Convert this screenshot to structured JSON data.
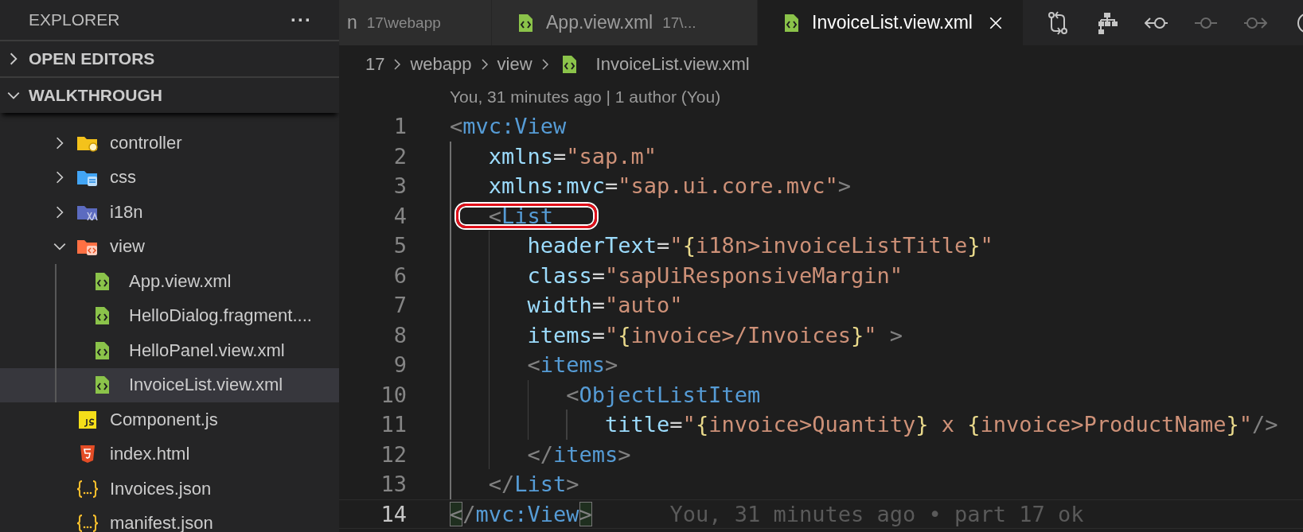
{
  "sidebar": {
    "title": "EXPLORER",
    "more": "···",
    "sections": [
      {
        "title": "OPEN EDITORS",
        "expanded": false
      },
      {
        "title": "WALKTHROUGH",
        "expanded": true,
        "tree": [
          {
            "label": "controller",
            "kind": "controller-folder",
            "expanded": false,
            "selected": false
          },
          {
            "label": "css",
            "kind": "css-folder",
            "expanded": false,
            "selected": false
          },
          {
            "label": "i18n",
            "kind": "i18n-folder",
            "expanded": false,
            "selected": false
          },
          {
            "label": "view",
            "kind": "view-folder",
            "expanded": true,
            "selected": false,
            "children": [
              {
                "label": "App.view.xml",
                "kind": "xml",
                "selected": false
              },
              {
                "label": "HelloDialog.fragment....",
                "kind": "xml",
                "selected": false
              },
              {
                "label": "HelloPanel.view.xml",
                "kind": "xml",
                "selected": false
              },
              {
                "label": "InvoiceList.view.xml",
                "kind": "xml",
                "selected": true
              }
            ]
          },
          {
            "label": "Component.js",
            "kind": "js",
            "selected": false
          },
          {
            "label": "index.html",
            "kind": "html",
            "selected": false
          },
          {
            "label": "Invoices.json",
            "kind": "json",
            "selected": false
          },
          {
            "label": "manifest.json",
            "kind": "json",
            "selected": false
          }
        ]
      }
    ]
  },
  "tabs": [
    {
      "label": "n",
      "description": "17\\webapp",
      "selected": false
    },
    {
      "label": "App.view.xml",
      "description": "17\\...",
      "kind": "xml",
      "selected": false
    },
    {
      "label": "InvoiceList.view.xml",
      "kind": "xml",
      "selected": true
    }
  ],
  "toolbar": [
    {
      "kind": "compare",
      "disabled": false
    },
    {
      "kind": "hierarchy",
      "disabled": false
    },
    {
      "kind": "prev-change",
      "disabled": false
    },
    {
      "kind": "commit",
      "disabled": true
    },
    {
      "kind": "next-change",
      "disabled": true
    },
    {
      "kind": "circle",
      "disabled": false
    }
  ],
  "breadcrumb": [
    {
      "label": "17"
    },
    {
      "label": "webapp"
    },
    {
      "label": "view"
    },
    {
      "label": "InvoiceList.view.xml",
      "kind": "xml"
    }
  ],
  "codelens": "You, 31 minutes ago | 1 author (You)",
  "lines": [
    {
      "number": "1",
      "circled": false,
      "current": false,
      "tokens": [
        {
          "kind": "punct",
          "text": "<"
        },
        {
          "kind": "tag",
          "text": "mvc:View"
        }
      ],
      "children": [
        {
          "number": "2",
          "circled": false,
          "current": false,
          "tokens": [
            {
              "kind": "attr",
              "text": "xmlns"
            },
            {
              "kind": "eq",
              "text": "="
            },
            {
              "kind": "string",
              "text": "\"sap.m\""
            }
          ]
        },
        {
          "number": "3",
          "circled": false,
          "current": false,
          "tokens": [
            {
              "kind": "attr",
              "text": "xmlns:mvc"
            },
            {
              "kind": "eq",
              "text": "="
            },
            {
              "kind": "string",
              "text": "\"sap.ui.core.mvc\""
            },
            {
              "kind": "punct",
              "text": ">"
            }
          ]
        },
        {
          "number": "4",
          "circled": true,
          "current": false,
          "tokens": [
            {
              "kind": "punct",
              "text": "<"
            },
            {
              "kind": "tag",
              "text": "List"
            }
          ],
          "children": [
            {
              "number": "5",
              "circled": false,
              "current": false,
              "tokens": [
                {
                  "kind": "attr",
                  "text": "headerText"
                },
                {
                  "kind": "eq",
                  "text": "="
                },
                {
                  "kind": "string",
                  "text": "\""
                },
                {
                  "kind": "brace",
                  "text": "{"
                },
                {
                  "kind": "string",
                  "text": "i18n>invoiceListTitle"
                },
                {
                  "kind": "brace",
                  "text": "}"
                },
                {
                  "kind": "string",
                  "text": "\""
                }
              ]
            },
            {
              "number": "6",
              "circled": false,
              "current": false,
              "tokens": [
                {
                  "kind": "attr",
                  "text": "class"
                },
                {
                  "kind": "eq",
                  "text": "="
                },
                {
                  "kind": "string",
                  "text": "\"sapUiResponsiveMargin\""
                }
              ]
            },
            {
              "number": "7",
              "circled": false,
              "current": false,
              "tokens": [
                {
                  "kind": "attr",
                  "text": "width"
                },
                {
                  "kind": "eq",
                  "text": "="
                },
                {
                  "kind": "string",
                  "text": "\"auto\""
                }
              ]
            },
            {
              "number": "8",
              "circled": false,
              "current": false,
              "tokens": [
                {
                  "kind": "attr",
                  "text": "items"
                },
                {
                  "kind": "eq",
                  "text": "="
                },
                {
                  "kind": "string",
                  "text": "\""
                },
                {
                  "kind": "brace",
                  "text": "{"
                },
                {
                  "kind": "string",
                  "text": "invoice>/Invoices"
                },
                {
                  "kind": "brace",
                  "text": "}"
                },
                {
                  "kind": "string",
                  "text": "\""
                },
                {
                  "kind": "punct",
                  "text": " >"
                }
              ]
            },
            {
              "number": "9",
              "circled": false,
              "current": false,
              "tokens": [
                {
                  "kind": "punct",
                  "text": "<"
                },
                {
                  "kind": "tag",
                  "text": "items"
                },
                {
                  "kind": "punct",
                  "text": ">"
                }
              ],
              "children": [
                {
                  "number": "10",
                  "circled": false,
                  "current": false,
                  "tokens": [
                    {
                      "kind": "punct",
                      "text": "<"
                    },
                    {
                      "kind": "tag",
                      "text": "ObjectListItem"
                    }
                  ],
                  "children": [
                    {
                      "number": "11",
                      "circled": false,
                      "current": false,
                      "tokens": [
                        {
                          "kind": "attr",
                          "text": "title"
                        },
                        {
                          "kind": "eq",
                          "text": "="
                        },
                        {
                          "kind": "string",
                          "text": "\""
                        },
                        {
                          "kind": "brace",
                          "text": "{"
                        },
                        {
                          "kind": "string",
                          "text": "invoice>Quantity"
                        },
                        {
                          "kind": "brace",
                          "text": "}"
                        },
                        {
                          "kind": "string",
                          "text": " x "
                        },
                        {
                          "kind": "brace",
                          "text": "{"
                        },
                        {
                          "kind": "string",
                          "text": "invoice>ProductName"
                        },
                        {
                          "kind": "brace",
                          "text": "}"
                        },
                        {
                          "kind": "string",
                          "text": "\""
                        },
                        {
                          "kind": "punct",
                          "text": "/>"
                        }
                      ]
                    }
                  ]
                }
              ]
            },
            {
              "number": "12",
              "circled": false,
              "current": false,
              "tokens": [
                {
                  "kind": "punct",
                  "text": "</"
                },
                {
                  "kind": "tag",
                  "text": "items"
                },
                {
                  "kind": "punct",
                  "text": ">"
                }
              ]
            }
          ]
        },
        {
          "number": "13",
          "circled": false,
          "current": false,
          "tokens": [
            {
              "kind": "punct",
              "text": "</"
            },
            {
              "kind": "tag",
              "text": "List"
            },
            {
              "kind": "punct",
              "text": ">"
            }
          ]
        }
      ]
    },
    {
      "number": "14",
      "circled": false,
      "current": true,
      "blame": "You, 31 minutes ago • part 17 ok",
      "tokens": [
        {
          "kind": "match",
          "text": "<"
        },
        {
          "kind": "punct",
          "text": "/"
        },
        {
          "kind": "tag",
          "text": "mvc:View"
        },
        {
          "kind": "match",
          "text": ">"
        }
      ]
    }
  ]
}
